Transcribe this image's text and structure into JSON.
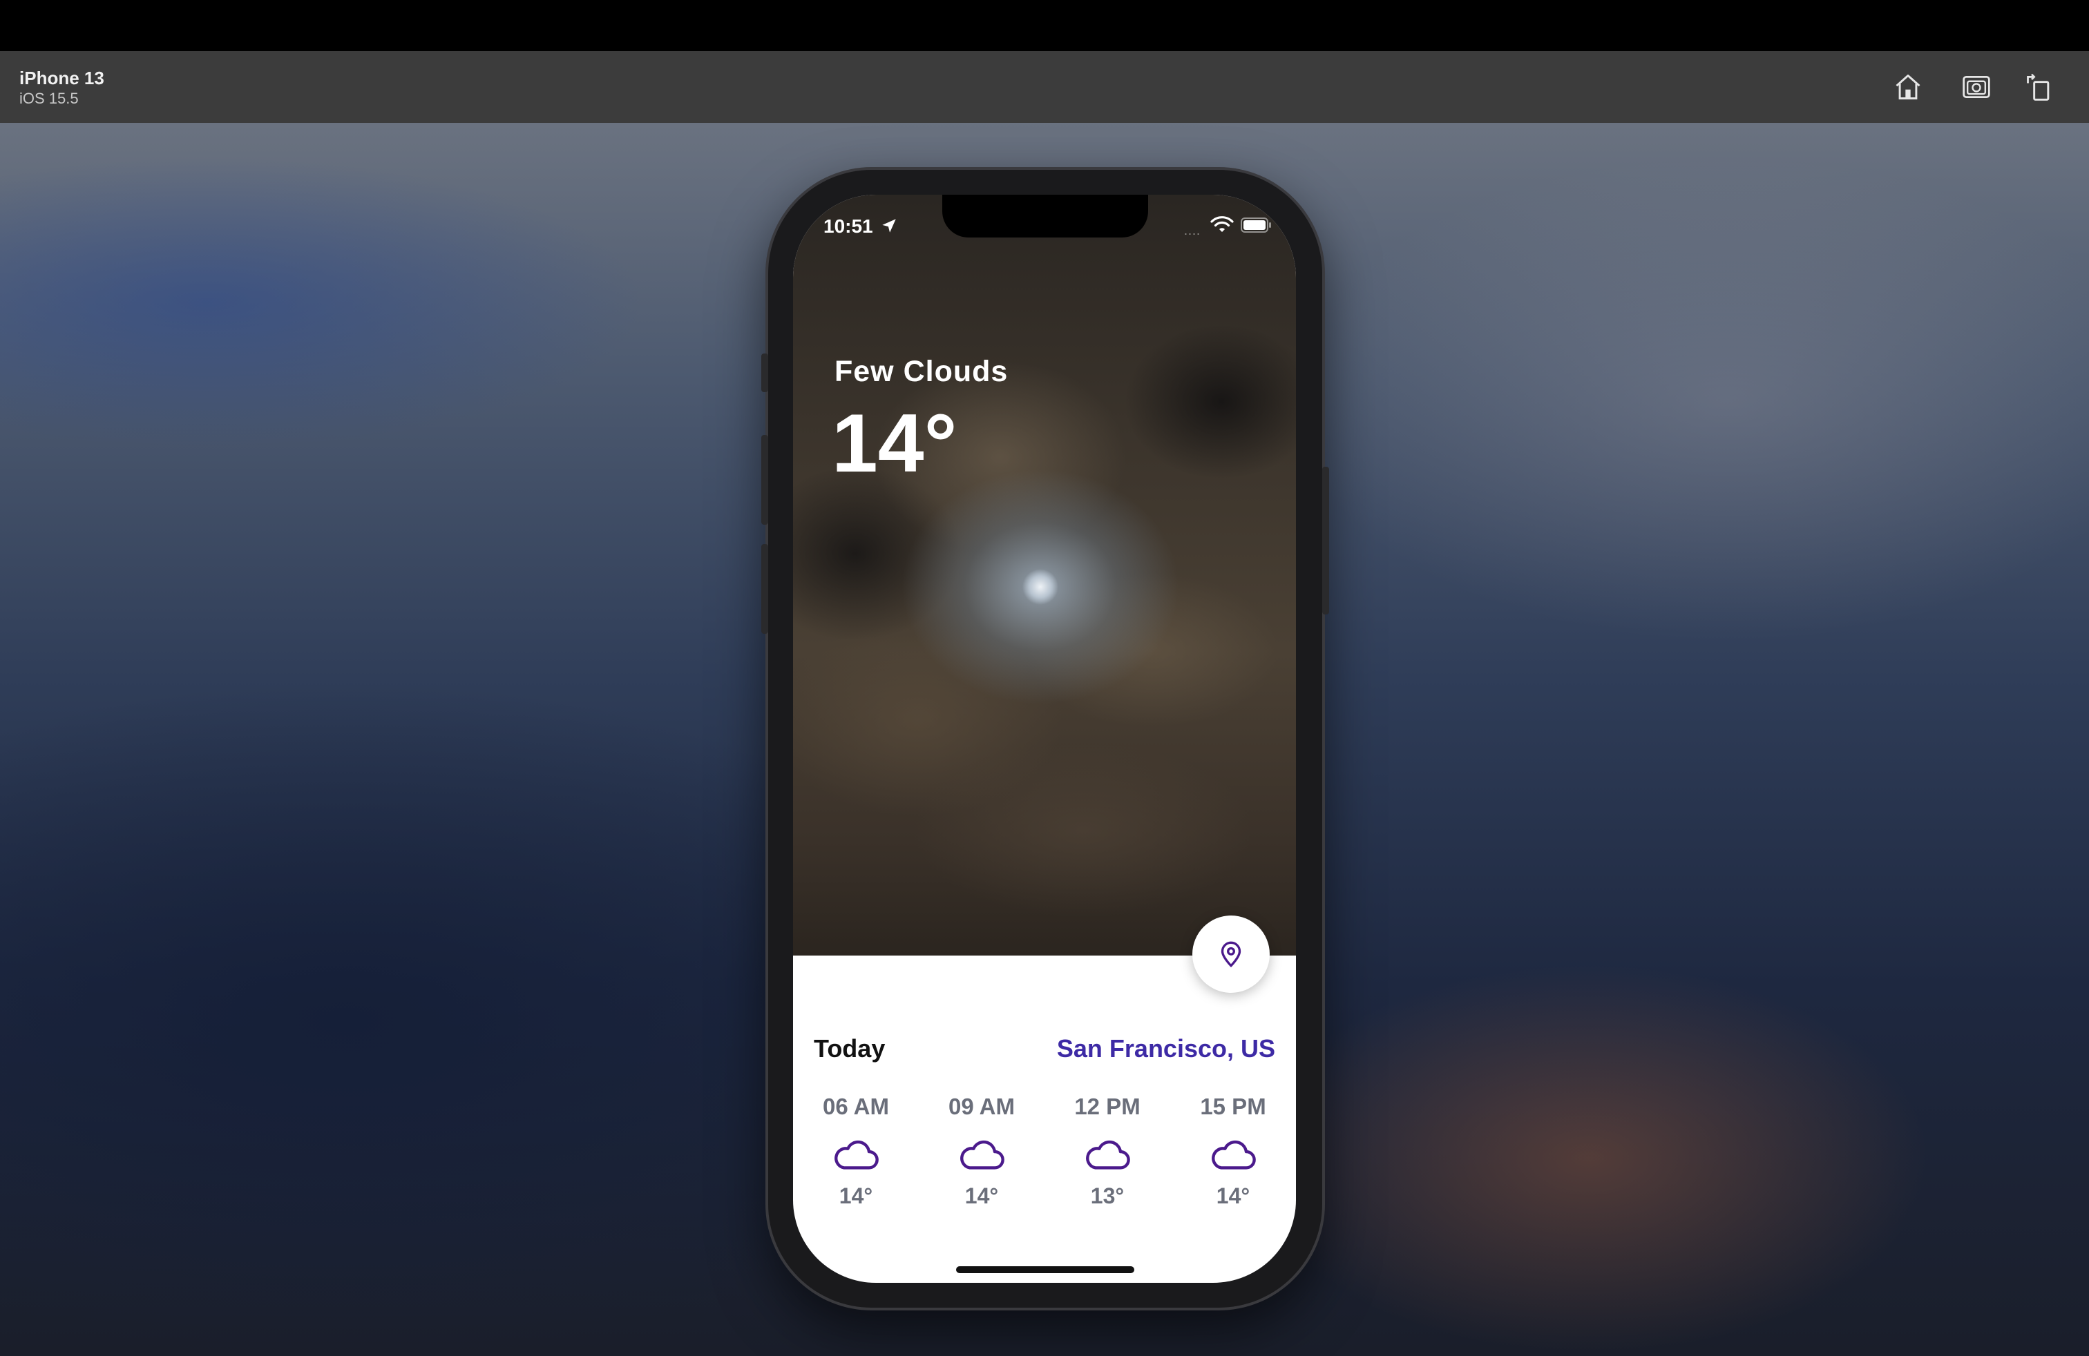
{
  "simulator": {
    "device_name": "iPhone 13",
    "os_version": "iOS 15.5",
    "toolbar_icons": [
      "home-icon",
      "screenshot-icon",
      "rotate-icon"
    ]
  },
  "status_bar": {
    "time": "10:51",
    "signal": "....",
    "icons": [
      "location-arrow-icon",
      "wifi-icon",
      "battery-icon"
    ]
  },
  "weather": {
    "condition": "Few Clouds",
    "temperature": "14°"
  },
  "forecast": {
    "title": "Today",
    "location": "San Francisco, US",
    "hours": [
      {
        "time": "06 AM",
        "icon": "cloud-icon",
        "temp": "14°"
      },
      {
        "time": "09 AM",
        "icon": "cloud-icon",
        "temp": "14°"
      },
      {
        "time": "12 PM",
        "icon": "cloud-icon",
        "temp": "13°"
      },
      {
        "time": "15 PM",
        "icon": "cloud-icon",
        "temp": "14°"
      }
    ]
  },
  "colors": {
    "accent": "#3d2aa5",
    "icon_purple": "#4b1a8c",
    "secondary_text": "#6a6e7a",
    "toolbar_bg": "#3c3c3c"
  }
}
